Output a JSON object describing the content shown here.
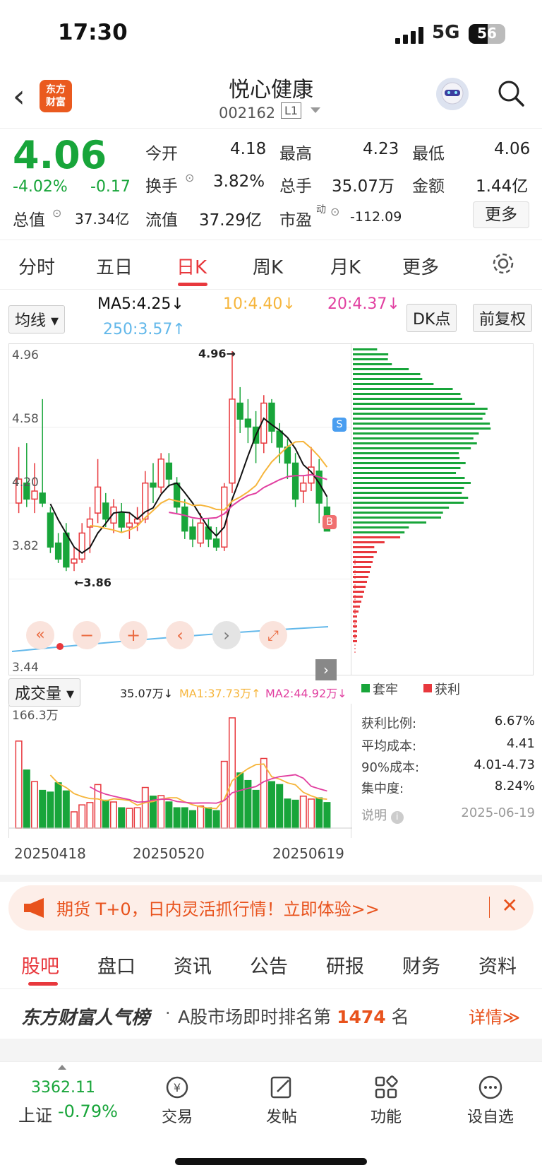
{
  "status": {
    "time": "17:30",
    "network": "5G",
    "battery": "56"
  },
  "nav": {
    "title": "悦心健康",
    "code": "002162",
    "level": "L1",
    "logo_line1": "东方",
    "logo_line2": "财富"
  },
  "quote": {
    "price": "4.06",
    "pct": "-4.02%",
    "chg": "-0.17",
    "open_label": "今开",
    "open": "4.18",
    "high_label": "最高",
    "high": "4.23",
    "low_label": "最低",
    "low": "4.06",
    "turnover_label": "换手",
    "turnover": "3.82%",
    "volume_label": "总手",
    "volume": "35.07万",
    "amount_label": "金额",
    "amount": "1.44亿",
    "mcap_label": "总值",
    "mcap": "37.34亿",
    "float_label": "流值",
    "float": "37.29亿",
    "pe_label": "市盈",
    "pe_sup": "动",
    "pe": "-112.09",
    "more": "更多"
  },
  "tabs": [
    "分时",
    "五日",
    "日K",
    "周K",
    "月K",
    "更多"
  ],
  "indicator": {
    "select": "均线",
    "ma5": "MA5:4.25↓",
    "ma10": "10:4.40↓",
    "ma20": "20:4.37↓",
    "ma250": "250:3.57↑",
    "dk": "DK点",
    "adjust": "前复权"
  },
  "chart_axis": {
    "p1": "4.96",
    "p2": "4.58",
    "p3": "4.20",
    "p4": "3.82",
    "p5": "3.44",
    "max_note": "4.96→",
    "min_note": "←3.86",
    "sell": "S",
    "buy": "B"
  },
  "volume": {
    "select": "成交量",
    "vol": "35.07万↓",
    "ma1": "MA1:37.73万↑",
    "ma2": "MA2:44.92万↓",
    "max": "166.3万"
  },
  "dates": [
    "20250418",
    "20250520",
    "20250619"
  ],
  "dist": {
    "legend_trap": "套牢",
    "legend_profit": "获利",
    "rows": [
      {
        "k": "获利比例:",
        "v": "6.67%"
      },
      {
        "k": "平均成本:",
        "v": "4.41"
      },
      {
        "k": "90%成本:",
        "v": "4.01-4.73"
      },
      {
        "k": "集中度:",
        "v": "8.24%"
      },
      {
        "k": "说明",
        "v": "2025-06-19"
      }
    ]
  },
  "banner": {
    "text": "期货 T+0，日内灵活抓行情！立即体验>>",
    "close": "✕"
  },
  "bottom_tabs": [
    "股吧",
    "盘口",
    "资讯",
    "公告",
    "研报",
    "财务",
    "资料"
  ],
  "rank": {
    "brand": "东方财富人气榜",
    "pre": "A股市场即时排名第",
    "num": "1474",
    "post": "名",
    "detail": "详情≫"
  },
  "footer": {
    "index_value": "3362.11",
    "index_name": "上证",
    "index_pct": "-0.79%",
    "trade": "交易",
    "post": "发帖",
    "func": "功能",
    "watch": "设自选"
  },
  "chart_data": {
    "type": "candlestick",
    "title": "",
    "ylim": [
      3.44,
      4.96
    ],
    "x_ticks": [
      "20250418",
      "20250520",
      "20250619"
    ],
    "last_close": 4.06,
    "ma": {
      "MA5": 4.25,
      "MA10": 4.4,
      "MA20": 4.37,
      "MA250": 3.57
    },
    "high_marker": 4.96,
    "low_marker": 3.86,
    "volume_max_label": "166.3万"
  },
  "colors": {
    "up": "#e8383d",
    "down": "#18a53a",
    "ma5": "#111111",
    "ma10": "#f6b53b",
    "ma20": "#e13fa0",
    "ma250": "#63b8ea",
    "accent": "#e8521c"
  }
}
